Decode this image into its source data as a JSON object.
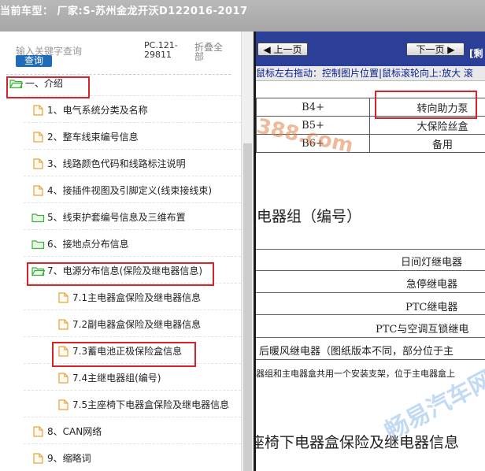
{
  "window": {
    "title": "当前车型：  厂家:S-苏州金龙开沃D122016-2017"
  },
  "search": {
    "label": "输入关键字查询",
    "button": "查询",
    "pc_number": "PC.121-29811",
    "fold_label": "折叠全部"
  },
  "tree": [
    {
      "label": "一、介绍",
      "icon": "folder-open-icon"
    },
    {
      "label": "1、电气系统分类及名称",
      "icon": "document-icon"
    },
    {
      "label": "2、整车线束编号信息",
      "icon": "document-icon"
    },
    {
      "label": "3、线路颜色代码和线路标注说明",
      "icon": "document-icon"
    },
    {
      "label": "4、接插件视图及引脚定义(线束接线束)",
      "icon": "document-icon"
    },
    {
      "label": "5、线束护套编号信息及三维布置",
      "icon": "folder-icon"
    },
    {
      "label": "6、接地点分布信息",
      "icon": "folder-icon"
    },
    {
      "label": "7、电源分布信息(保险及继电器信息)",
      "icon": "folder-open-icon"
    },
    {
      "label": "7.1主电器盒保险及继电器信息",
      "icon": "document-icon"
    },
    {
      "label": "7.2副电器盒保险及继电器信息",
      "icon": "document-icon"
    },
    {
      "label": "7.3蓄电池正极保险盒信息",
      "icon": "document-icon"
    },
    {
      "label": "7.4主继电器组(编号)",
      "icon": "document-icon"
    },
    {
      "label": "7.5主座椅下电器盒保险及继电器信息",
      "icon": "document-icon"
    },
    {
      "label": "8、CAN网络",
      "icon": "document-icon"
    },
    {
      "label": "9、缩略词",
      "icon": "document-icon"
    }
  ],
  "viewer": {
    "prev_label": "上一页",
    "next_label": "下一页",
    "extra_label": "[剩",
    "tip": "鼠标左右拖动：控制图片位置|鼠标滚轮向上:放大  滚",
    "fuse_table": [
      {
        "code": "B4+",
        "name": "转向助力泵"
      },
      {
        "code": "B5+",
        "name": "大保险丝盒"
      },
      {
        "code": "B6+",
        "name": "备用"
      }
    ],
    "relay_heading": "继电器组（编号）",
    "relays": [
      "日间灯继电器",
      "急停继电器",
      "PTC继电器",
      "PTC与空调互锁继电"
    ],
    "note1": "后暖风继电器（图纸版本不同，部分位于主",
    "note2": "器组和主电器盒共用一个安装支架，位于主电器盒上",
    "seat_heading": "座椅下电器盒保险及继电器信息"
  },
  "watermarks": {
    "top": "388.com",
    "bottom": "畅易汽车网"
  },
  "colors": {
    "highlight": "#d8232a",
    "nav": "#2b3f98",
    "search_button": "#1f6db8",
    "folder": "#3fae3f",
    "document": "#e8a23c"
  }
}
